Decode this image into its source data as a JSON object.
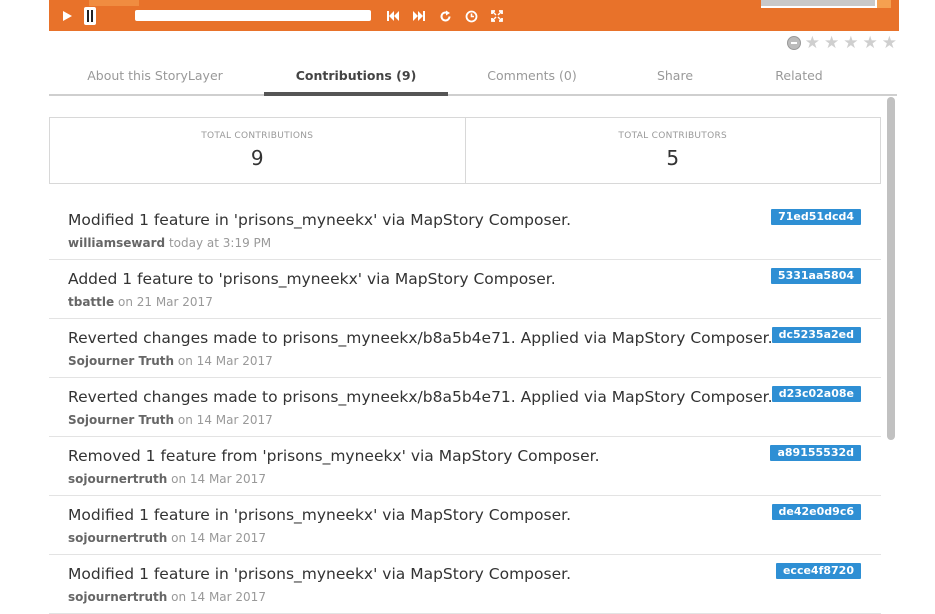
{
  "player": {
    "accent_color": "#e8722a",
    "controls": [
      "play-icon",
      "skip-back-icon",
      "skip-forward-icon",
      "repeat-icon",
      "clock-icon",
      "fullscreen-icon"
    ]
  },
  "rating": {
    "stars": 5,
    "value": 0
  },
  "tabs": [
    {
      "label": "About this StoryLayer"
    },
    {
      "label": "Contributions (9)"
    },
    {
      "label": "Comments (0)"
    },
    {
      "label": "Share"
    },
    {
      "label": "Related"
    }
  ],
  "summary": {
    "total_contributions_label": "TOTAL CONTRIBUTIONS",
    "total_contributions": "9",
    "total_contributors_label": "TOTAL CONTRIBUTORS",
    "total_contributors": "5"
  },
  "contributions": [
    {
      "message": "Modified 1 feature in 'prisons_myneekx' via MapStory Composer.",
      "user": "williamseward",
      "when": "today at 3:19 PM",
      "hash": "71ed51dcd4"
    },
    {
      "message": "Added 1 feature to 'prisons_myneekx' via MapStory Composer.",
      "user": "tbattle",
      "when": "on 21 Mar 2017",
      "hash": "5331aa5804"
    },
    {
      "message": "Reverted changes made to prisons_myneekx/b8a5b4e71. Applied via MapStory Composer.",
      "user": "Sojourner Truth",
      "when": "on 14 Mar 2017",
      "hash": "dc5235a2ed"
    },
    {
      "message": "Reverted changes made to prisons_myneekx/b8a5b4e71. Applied via MapStory Composer.",
      "user": "Sojourner Truth",
      "when": "on 14 Mar 2017",
      "hash": "d23c02a08e"
    },
    {
      "message": "Removed 1 feature from 'prisons_myneekx' via MapStory Composer.",
      "user": "sojournertruth",
      "when": "on 14 Mar 2017",
      "hash": "a89155532d"
    },
    {
      "message": "Modified 1 feature in 'prisons_myneekx' via MapStory Composer.",
      "user": "sojournertruth",
      "when": "on 14 Mar 2017",
      "hash": "de42e0d9c6"
    },
    {
      "message": "Modified 1 feature in 'prisons_myneekx' via MapStory Composer.",
      "user": "sojournertruth",
      "when": "on 14 Mar 2017",
      "hash": "ecce4f8720"
    }
  ]
}
